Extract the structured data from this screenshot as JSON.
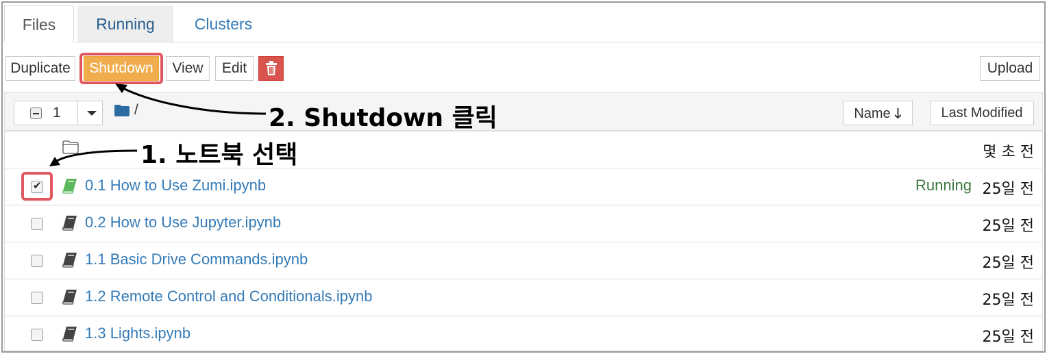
{
  "tabs": [
    {
      "label": "Files",
      "active": true
    },
    {
      "label": "Running",
      "active": false
    },
    {
      "label": "Clusters",
      "active": false
    }
  ],
  "toolbar": {
    "duplicate": "Duplicate",
    "shutdown": "Shutdown",
    "view": "View",
    "edit": "Edit",
    "delete_icon": "trash-icon",
    "upload": "Upload"
  },
  "list_header": {
    "selected_count": "1",
    "breadcrumb": "/",
    "sort_name": "Name",
    "sort_name_icon": "arrow-down-icon",
    "sort_last_modified": "Last Modified"
  },
  "parent_row": {
    "name": "..",
    "modified": "몇 초 전"
  },
  "files": [
    {
      "name": "0.1 How to Use Zumi.ipynb",
      "status": "Running",
      "modified": "25일 전",
      "checked": true
    },
    {
      "name": "0.2 How to Use Jupyter.ipynb",
      "status": "",
      "modified": "25일 전",
      "checked": false
    },
    {
      "name": "1.1 Basic Drive Commands.ipynb",
      "status": "",
      "modified": "25일 전",
      "checked": false
    },
    {
      "name": "1.2 Remote Control and Conditionals.ipynb",
      "status": "",
      "modified": "25일 전",
      "checked": false
    },
    {
      "name": "1.3 Lights.ipynb",
      "status": "",
      "modified": "25일 전",
      "checked": false
    }
  ],
  "annotations": {
    "step1": "1. 노트북 선택",
    "step2": "2. Shutdown 클릭"
  },
  "colors": {
    "shutdown": "#f0ad4e",
    "delete": "#d9534f",
    "link": "#337ab7",
    "running": "#3c763d",
    "highlight": "#e0575f"
  }
}
